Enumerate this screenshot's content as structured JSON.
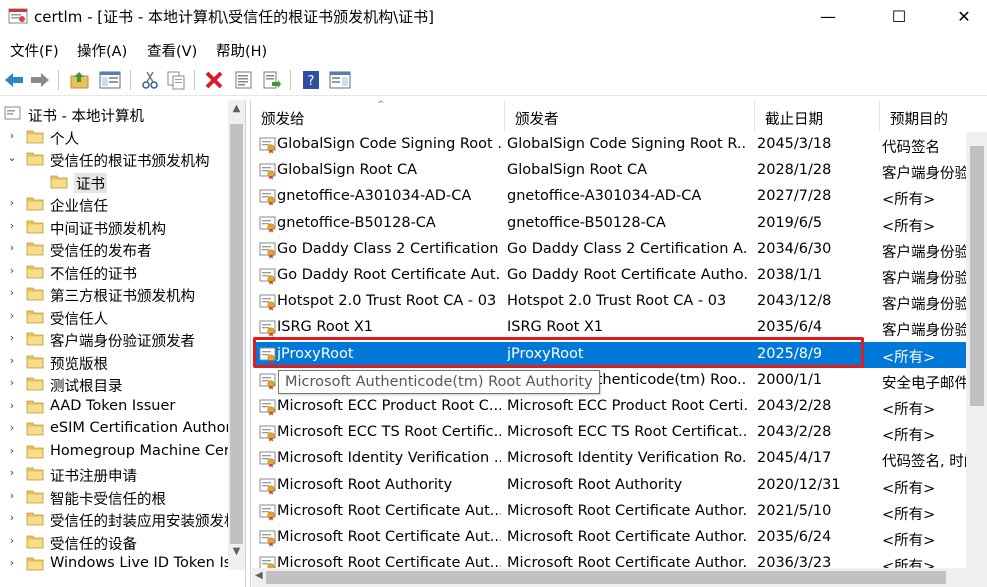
{
  "window": {
    "app_name": "certlm",
    "title": "certlm - [证书 - 本地计算机\\受信任的根证书颁发机构\\证书]",
    "minimize_glyph": "—",
    "maximize_glyph": "☐",
    "close_glyph": "✕"
  },
  "menu": [
    "文件(F)",
    "操作(A)",
    "查看(V)",
    "帮助(H)"
  ],
  "toolbar": {
    "icons": [
      "back-icon",
      "forward-icon",
      "up-folder-icon",
      "show-hide-tree-icon",
      "cut-icon",
      "copy-icon",
      "delete-icon",
      "properties-icon",
      "export-list-icon",
      "help-icon",
      "action-pane-icon"
    ]
  },
  "tree": {
    "items": [
      {
        "label": "证书 - 本地计算机",
        "level": 0,
        "expander": ""
      },
      {
        "label": "个人",
        "level": 1,
        "expander": "›"
      },
      {
        "label": "受信任的根证书颁发机构",
        "level": 1,
        "expander": "⌄"
      },
      {
        "label": "证书",
        "level": 2,
        "expander": "",
        "selected": true
      },
      {
        "label": "企业信任",
        "level": 1,
        "expander": "›"
      },
      {
        "label": "中间证书颁发机构",
        "level": 1,
        "expander": "›"
      },
      {
        "label": "受信任的发布者",
        "level": 1,
        "expander": "›"
      },
      {
        "label": "不信任的证书",
        "level": 1,
        "expander": "›"
      },
      {
        "label": "第三方根证书颁发机构",
        "level": 1,
        "expander": "›"
      },
      {
        "label": "受信任人",
        "level": 1,
        "expander": "›"
      },
      {
        "label": "客户端身份验证颁发者",
        "level": 1,
        "expander": "›"
      },
      {
        "label": "预览版根",
        "level": 1,
        "expander": "›"
      },
      {
        "label": "测试根目录",
        "level": 1,
        "expander": "›"
      },
      {
        "label": "AAD Token Issuer",
        "level": 1,
        "expander": "›"
      },
      {
        "label": "eSIM Certification Authorities",
        "level": 1,
        "expander": "›"
      },
      {
        "label": "Homegroup Machine Certificates",
        "level": 1,
        "expander": "›"
      },
      {
        "label": "证书注册申请",
        "level": 1,
        "expander": "›"
      },
      {
        "label": "智能卡受信任的根",
        "level": 1,
        "expander": "›"
      },
      {
        "label": "受信任的封装应用安装颁发机构",
        "level": 1,
        "expander": "›"
      },
      {
        "label": "受信任的设备",
        "level": 1,
        "expander": "›"
      },
      {
        "label": "Windows Live ID Token Issuer",
        "level": 1,
        "expander": "›"
      }
    ]
  },
  "columns": [
    "颁发给",
    "颁发者",
    "截止日期",
    "预期目的"
  ],
  "rows": [
    {
      "issued_to": "GlobalSign Code Signing Root ...",
      "issuer": "GlobalSign Code Signing Root R...",
      "expires": "2045/3/18",
      "purpose": "代码签名"
    },
    {
      "issued_to": "GlobalSign Root CA",
      "issuer": "GlobalSign Root CA",
      "expires": "2028/1/28",
      "purpose": "客户端身份验证"
    },
    {
      "issued_to": "gnetoffice-A301034-AD-CA",
      "issuer": "gnetoffice-A301034-AD-CA",
      "expires": "2027/7/28",
      "purpose": "<所有>"
    },
    {
      "issued_to": "gnetoffice-B50128-CA",
      "issuer": "gnetoffice-B50128-CA",
      "expires": "2019/6/5",
      "purpose": "<所有>"
    },
    {
      "issued_to": "Go Daddy Class 2 Certification ...",
      "issuer": "Go Daddy Class 2 Certification A...",
      "expires": "2034/6/30",
      "purpose": "客户端身份验证"
    },
    {
      "issued_to": "Go Daddy Root Certificate Aut...",
      "issuer": "Go Daddy Root Certificate Autho...",
      "expires": "2038/1/1",
      "purpose": "客户端身份验证"
    },
    {
      "issued_to": "Hotspot 2.0 Trust Root CA - 03",
      "issuer": "Hotspot 2.0 Trust Root CA - 03",
      "expires": "2043/12/8",
      "purpose": "客户端身份验证"
    },
    {
      "issued_to": "ISRG Root X1",
      "issuer": "ISRG Root X1",
      "expires": "2035/6/4",
      "purpose": "客户端身份验证"
    },
    {
      "issued_to": "jProxyRoot",
      "issuer": "jProxyRoot",
      "expires": "2025/8/9",
      "purpose": "<所有>",
      "selected": true
    },
    {
      "issued_to": "Microsoft Authenticode(tm) Ro...",
      "issuer": "Microsoft Authenticode(tm) Roo...",
      "expires": "2000/1/1",
      "purpose": "安全电子邮件"
    },
    {
      "issued_to": "Microsoft ECC Product Root C...",
      "issuer": "Microsoft ECC Product Root Certi...",
      "expires": "2043/2/28",
      "purpose": "<所有>"
    },
    {
      "issued_to": "Microsoft ECC TS Root Certific...",
      "issuer": "Microsoft ECC TS Root Certificat...",
      "expires": "2043/2/28",
      "purpose": "<所有>"
    },
    {
      "issued_to": "Microsoft Identity Verification ...",
      "issuer": "Microsoft Identity Verification Ro...",
      "expires": "2045/4/17",
      "purpose": "代码签名, 时间戳"
    },
    {
      "issued_to": "Microsoft Root Authority",
      "issuer": "Microsoft Root Authority",
      "expires": "2020/12/31",
      "purpose": "<所有>"
    },
    {
      "issued_to": "Microsoft Root Certificate Aut...",
      "issuer": "Microsoft Root Certificate Author...",
      "expires": "2021/5/10",
      "purpose": "<所有>"
    },
    {
      "issued_to": "Microsoft Root Certificate Aut...",
      "issuer": "Microsoft Root Certificate Author...",
      "expires": "2035/6/24",
      "purpose": "<所有>"
    },
    {
      "issued_to": "Microsoft Root Certificate Aut...",
      "issuer": "Microsoft Root Certificate Author...",
      "expires": "2036/3/23",
      "purpose": "<所有>"
    }
  ],
  "tooltip": "Microsoft Authenticode(tm) Root Authority",
  "colors": {
    "selection": "#0078d7",
    "highlight_box": "#e21c1c",
    "folder": "#e8c15a"
  }
}
